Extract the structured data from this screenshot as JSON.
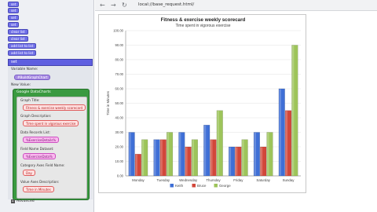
{
  "left_panel": {
    "top_blocks": [
      "set",
      "set",
      "set",
      "set",
      "clear list",
      "clear list",
      "add list to list",
      "add list to list"
    ],
    "header": "set",
    "variable_name_label": "Variable Name:",
    "variable_name_value": "#BuildGraphChart",
    "new_value_label": "New Value:",
    "green_block_title": "Google DataCharts",
    "fields": [
      {
        "label": "Graph Title:",
        "value": "Fitness & exercise weekly scorecard"
      },
      {
        "label": "Graph Description:",
        "value": "Time spent in vigorous exercise"
      },
      {
        "label": "Data Records List:",
        "value": "%ExerciseDetails%"
      },
      {
        "label": "Field Name Dataset:",
        "value": "%ExerciseData%"
      },
      {
        "label": "Category Axes Field Name:",
        "value": "Day"
      },
      {
        "label": "Value Axes Description:",
        "value": "Time in Minutes"
      }
    ],
    "advanced_label": "Advanced"
  },
  "browser": {
    "back_icon": "back-arrow-icon",
    "forward_icon": "forward-arrow-icon",
    "reload_icon": "reload-icon",
    "url": "local://base_request.html/"
  },
  "colors": {
    "Keith": "#3f6fd6",
    "Bruce": "#d2473a",
    "George": "#9dc45a"
  },
  "chart_data": {
    "type": "bar",
    "title": "Fitness & exercise weekly scorecard",
    "subtitle": "Time spent in vigorous exercise",
    "ylabel": "Time in Minutes",
    "xlabel": "",
    "ylim": [
      0,
      100
    ],
    "yticks": [
      "0.00",
      "10.00",
      "20.00",
      "30.00",
      "40.00",
      "50.00",
      "60.00",
      "70.00",
      "80.00",
      "90.00",
      "100.00"
    ],
    "categories": [
      "Monday",
      "Tuesday",
      "Wednesday",
      "Thursday",
      "Friday",
      "Saturday",
      "Sunday"
    ],
    "series": [
      {
        "name": "Keith",
        "values": [
          30,
          25,
          30,
          35,
          20,
          30,
          60
        ]
      },
      {
        "name": "Bruce",
        "values": [
          15,
          25,
          20,
          25,
          20,
          20,
          45
        ]
      },
      {
        "name": "George",
        "values": [
          25,
          30,
          25,
          45,
          25,
          30,
          90
        ]
      }
    ],
    "grid": true,
    "legend_position": "bottom"
  }
}
